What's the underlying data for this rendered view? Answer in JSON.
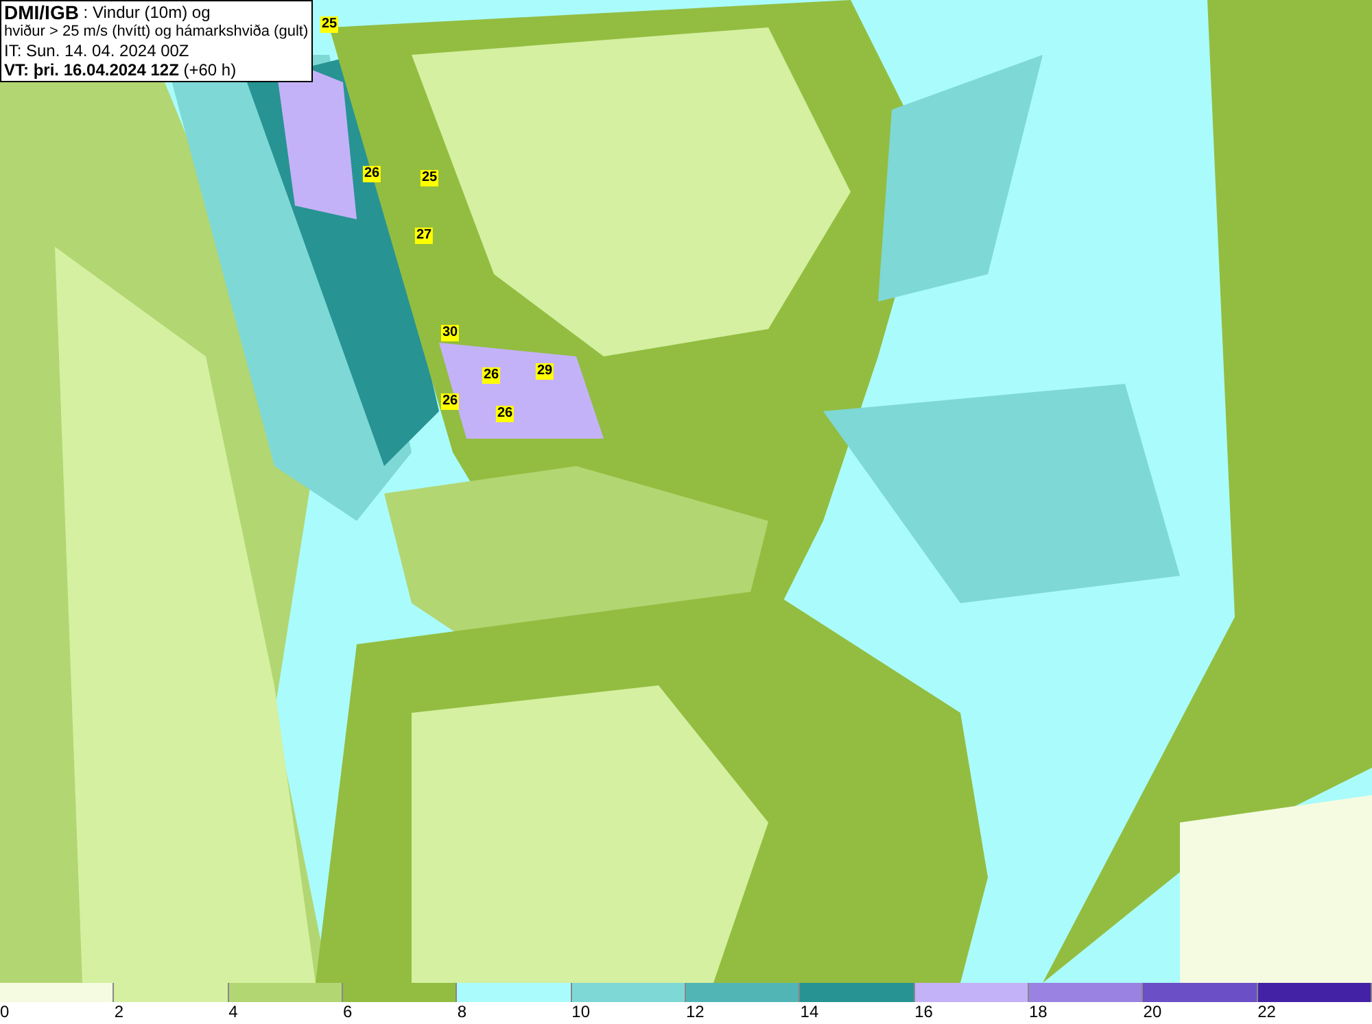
{
  "header": {
    "source": "DMI/IGB",
    "title_rest": " : Vindur (10m) og",
    "line2": "hviður > 25 m/s (hvítt) og hámarkshviða (gult)",
    "init_time": "IT: Sun. 14. 04. 2024 00Z",
    "valid_label": "VT: þri. 16.04.2024 12Z",
    "valid_offset": " (+60 h)"
  },
  "map": {
    "gust_labels": [
      "25",
      "26",
      "25",
      "27",
      "30",
      "29",
      "26",
      "26",
      "26"
    ]
  },
  "legend": [
    {
      "label": "0",
      "color": "#f5fbe0"
    },
    {
      "label": "2",
      "color": "#d4f0a0"
    },
    {
      "label": "4",
      "color": "#b2d672"
    },
    {
      "label": "6",
      "color": "#93bd40"
    },
    {
      "label": "8",
      "color": "#aafbfb"
    },
    {
      "label": "10",
      "color": "#7ed8d6"
    },
    {
      "label": "12",
      "color": "#52b5b5"
    },
    {
      "label": "14",
      "color": "#279393"
    },
    {
      "label": "16",
      "color": "#c4b2f8"
    },
    {
      "label": "18",
      "color": "#9a82e2"
    },
    {
      "label": "20",
      "color": "#6b4fc6"
    },
    {
      "label": "22",
      "color": "#4422a6"
    }
  ]
}
